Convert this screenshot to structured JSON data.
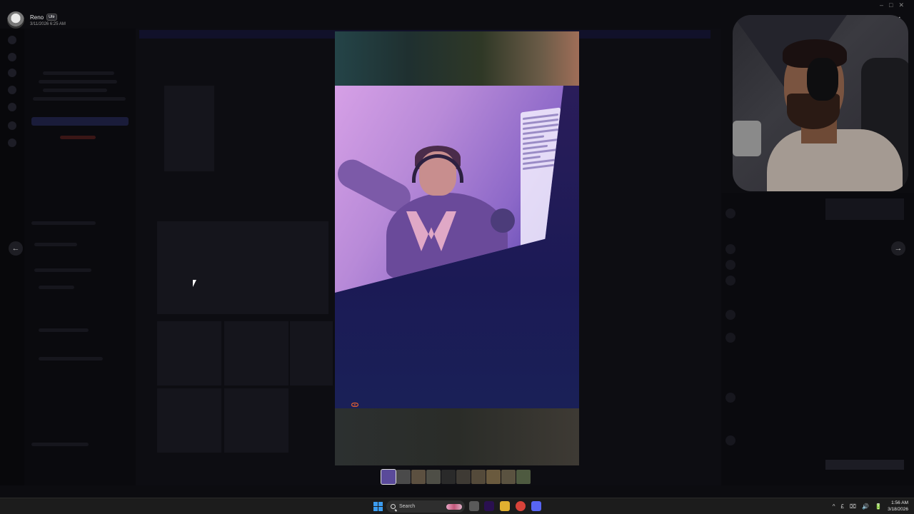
{
  "viewer": {
    "author": "Reno",
    "badge": "Ultr",
    "timestamp": "3/11/2026 6:25 AM",
    "close_symbol": "✕",
    "prev_symbol": "←",
    "next_symbol": "→"
  },
  "media": {
    "date_stamp": "'61 10 E"
  },
  "thumbnails": [
    {
      "color": "#5a4a9a",
      "active": true
    },
    {
      "color": "#4a4a4a",
      "active": false
    },
    {
      "color": "#5c5040",
      "active": false
    },
    {
      "color": "#4e4e46",
      "active": false
    },
    {
      "color": "#2a2a2a",
      "active": false
    },
    {
      "color": "#3e3a34",
      "active": false
    },
    {
      "color": "#544a3a",
      "active": false
    },
    {
      "color": "#6a5a3e",
      "active": false
    },
    {
      "color": "#5a5240",
      "active": false
    },
    {
      "color": "#4e5a40",
      "active": false
    }
  ],
  "taskbar": {
    "search_label": "Search",
    "icons": [
      {
        "name": "task-view-icon",
        "color": "#5a5a5a"
      },
      {
        "name": "premiere-icon",
        "color": "#2a1050"
      },
      {
        "name": "file-explorer-icon",
        "color": "#e0b030"
      },
      {
        "name": "chrome-icon",
        "color": "#d8433a"
      },
      {
        "name": "discord-icon",
        "color": "#5865f2"
      }
    ],
    "clock_time": "1:56 AM",
    "clock_date": "3/18/2026",
    "tray": [
      "^",
      "£",
      "⌧",
      "🔊",
      "🔋"
    ]
  }
}
